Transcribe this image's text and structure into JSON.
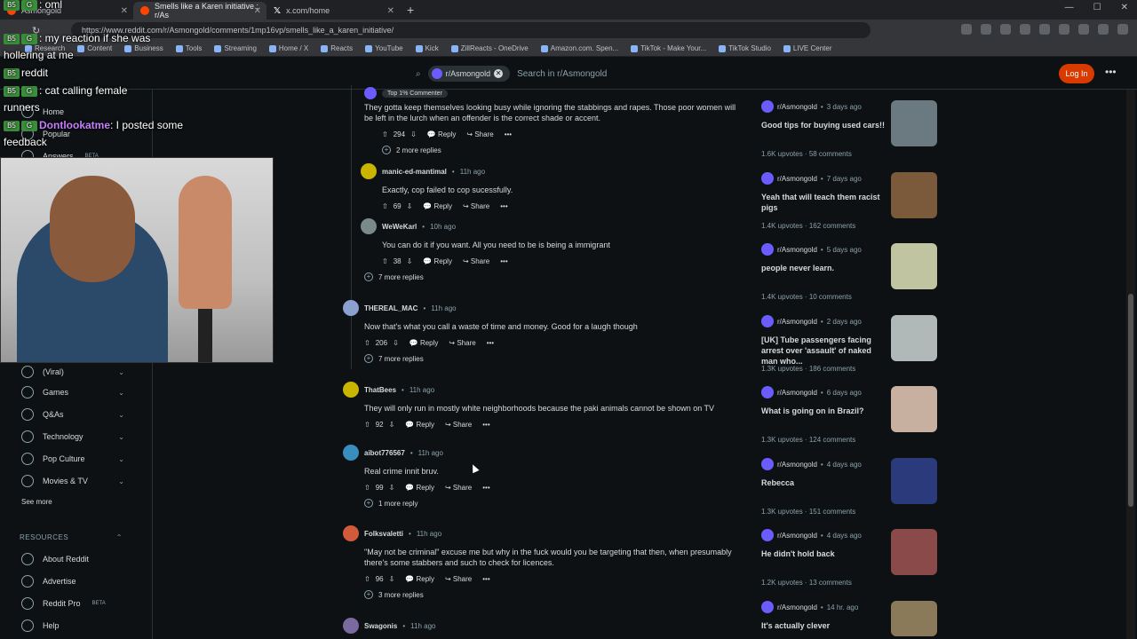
{
  "browser": {
    "tabs": [
      {
        "label": "Asmongold",
        "active": false
      },
      {
        "label": "Smells like a Karen initiative : r/As",
        "active": true
      },
      {
        "label": "x.com/home",
        "active": false
      }
    ],
    "url": "https://www.reddit.com/r/Asmongold/comments/1mp16vp/smells_like_a_karen_initiative/",
    "bookmarks": [
      "Research",
      "Content",
      "Business",
      "Tools",
      "Streaming",
      "Home / X",
      "Reacts",
      "YouTube",
      "Kick",
      "ZillReacts - OneDrive",
      "Amazon.com. Spen...",
      "TikTok - Make Your...",
      "TikTok Studio",
      "LIVE Center"
    ]
  },
  "header": {
    "subreddit_chip": "r/Asmongold",
    "search_placeholder": "Search in r/Asmongold",
    "login_label": "Log In",
    "more_label": "•••"
  },
  "overlay": {
    "chat": [
      {
        "user": "",
        "text": ": oml"
      },
      {
        "user": "",
        "text": ": my reaction if she was"
      },
      {
        "user": "",
        "text": "hollering at me"
      },
      {
        "user": "",
        "text": "reddit"
      },
      {
        "user": "",
        "text": ": cat calling female"
      },
      {
        "user": "",
        "text": "runners"
      },
      {
        "user": "Dontlookatme",
        "text": ": I posted some"
      },
      {
        "user": "",
        "text": "feedback"
      }
    ]
  },
  "sidebar": {
    "top_items": [
      {
        "label": "Home"
      },
      {
        "label": "Popular"
      },
      {
        "label": "Answers",
        "badge": "BETA"
      }
    ],
    "topics": [
      {
        "label": "(Viral)"
      },
      {
        "label": "Games"
      },
      {
        "label": "Q&As"
      },
      {
        "label": "Technology"
      },
      {
        "label": "Pop Culture"
      },
      {
        "label": "Movies & TV"
      }
    ],
    "see_more": "See more",
    "resources_header": "RESOURCES",
    "resources": [
      {
        "label": "About Reddit"
      },
      {
        "label": "Advertise"
      },
      {
        "label": "Reddit Pro",
        "badge": "BETA"
      },
      {
        "label": "Help"
      }
    ]
  },
  "comments": [
    {
      "user": "",
      "time": "",
      "badge": "Top 1% Commenter",
      "body": "They gotta keep themselves looking busy while ignoring the stabbings and rapes. Those poor women will be left in the lurch when an offender is the correct shade or accent.",
      "score": "294",
      "more": "2 more replies"
    },
    {
      "user": "manic-ed-mantimal",
      "time": "11h ago",
      "body": "Exactly, cop failed to cop sucessfully.",
      "score": "69"
    },
    {
      "user": "WeWeKarl",
      "time": "10h ago",
      "body": "You can do it if you want. All you need to be is being a immigrant",
      "score": "38",
      "more": "7 more replies"
    },
    {
      "user": "THEREAL_MAC",
      "time": "11h ago",
      "body": "Now that's what you call a waste of time and money. Good for a laugh though",
      "score": "206",
      "more": "7 more replies"
    },
    {
      "user": "ThatBees",
      "time": "11h ago",
      "body": "They will only run in mostly white neighborhoods because the paki animals cannot be shown on TV",
      "score": "92"
    },
    {
      "user": "aibot776567",
      "time": "11h ago",
      "body": "Real crime innit bruv.",
      "score": "99",
      "more": "1 more reply"
    },
    {
      "user": "Folksvaletti",
      "time": "11h ago",
      "body": "\"May not be criminal\" excuse me but why in the fuck would you be targeting that then, when presumably there's some stabbers and such to check for licences.",
      "score": "96",
      "more": "3 more replies"
    },
    {
      "user": "Swagonis",
      "time": "11h ago",
      "body": "",
      "score": ""
    }
  ],
  "actions": {
    "reply": "Reply",
    "share": "Share",
    "dots": "•••"
  },
  "related": [
    {
      "sub": "r/Asmongold",
      "time": "3 days ago",
      "title": "Good tips for buying used cars!!",
      "upvotes": "1.6K upvotes",
      "comments": "58 comments"
    },
    {
      "sub": "r/Asmongold",
      "time": "7 days ago",
      "title": "Yeah that will teach them racist pigs",
      "upvotes": "1.4K upvotes",
      "comments": "162 comments"
    },
    {
      "sub": "r/Asmongold",
      "time": "5 days ago",
      "title": "people never learn.",
      "upvotes": "1.4K upvotes",
      "comments": "10 comments"
    },
    {
      "sub": "r/Asmongold",
      "time": "2 days ago",
      "title": "[UK] Tube passengers facing arrest over 'assault' of naked man who...",
      "upvotes": "1.3K upvotes",
      "comments": "186 comments"
    },
    {
      "sub": "r/Asmongold",
      "time": "6 days ago",
      "title": "What is going on in Brazil?",
      "upvotes": "1.3K upvotes",
      "comments": "124 comments"
    },
    {
      "sub": "r/Asmongold",
      "time": "4 days ago",
      "title": "Rebecca",
      "upvotes": "1.3K upvotes",
      "comments": "151 comments"
    },
    {
      "sub": "r/Asmongold",
      "time": "4 days ago",
      "title": "He didn't hold back",
      "upvotes": "1.2K upvotes",
      "comments": "13 comments"
    },
    {
      "sub": "r/Asmongold",
      "time": "14 hr. ago",
      "title": "It's actually clever",
      "upvotes": "",
      "comments": ""
    }
  ],
  "colors": {
    "accent": "#d93a00",
    "bg": "#0e1113",
    "text": "#d7dadc",
    "muted": "#8ba2ad"
  }
}
